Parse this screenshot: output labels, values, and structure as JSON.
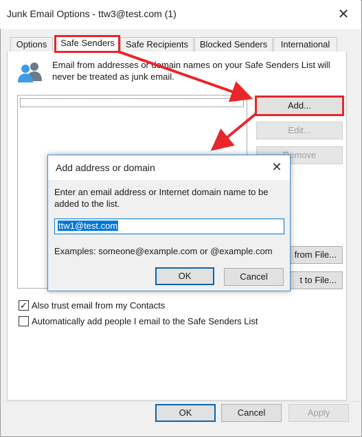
{
  "window": {
    "title": "Junk Email Options - ttw3@test.com (1)",
    "close_glyph": "✕"
  },
  "tabs": [
    {
      "label": "Options",
      "active": false
    },
    {
      "label": "Safe Senders",
      "active": true
    },
    {
      "label": "Safe Recipients",
      "active": false
    },
    {
      "label": "Blocked Senders",
      "active": false
    },
    {
      "label": "International",
      "active": false
    }
  ],
  "panel": {
    "icon": "people-icon",
    "description": "Email from addresses or domain names on your Safe Senders List will never be treated as junk email.",
    "buttons": {
      "add": "Add...",
      "edit": "Edit...",
      "remove": "Remove",
      "import": "from File...",
      "export": "t to File..."
    },
    "checkboxes": [
      {
        "label": "Also trust email from my Contacts",
        "checked": true
      },
      {
        "label": "Automatically add people I email to the Safe Senders List",
        "checked": false
      }
    ]
  },
  "footer": {
    "ok": "OK",
    "cancel": "Cancel",
    "apply": "Apply"
  },
  "dialog": {
    "title": "Add address or domain",
    "close_glyph": "✕",
    "prompt": "Enter an email address or Internet domain name to be added to the list.",
    "input_value": "ttw1@test.com",
    "examples": "Examples: someone@example.com or @example.com",
    "ok": "OK",
    "cancel": "Cancel"
  },
  "colors": {
    "highlight": "#e8262b",
    "accent": "#0078d7"
  }
}
